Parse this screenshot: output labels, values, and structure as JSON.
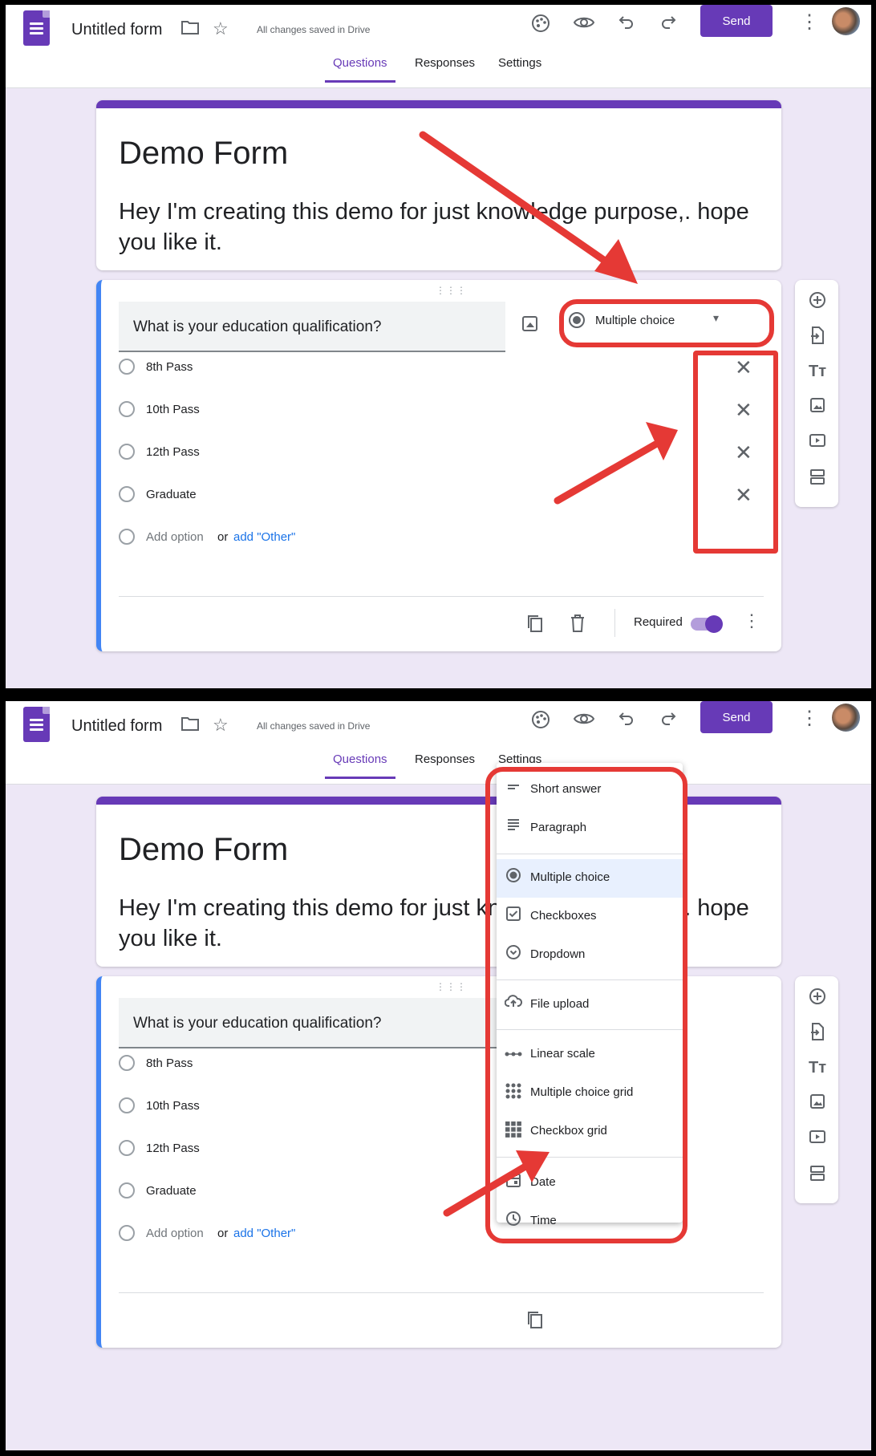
{
  "app": {
    "title": "Untitled form",
    "saved_status": "All changes saved in Drive",
    "send_label": "Send",
    "tabs": [
      "Questions",
      "Responses",
      "Settings"
    ]
  },
  "form": {
    "title": "Demo Form",
    "description": "Hey I'm creating this demo for just knowledge purpose,. hope you like it."
  },
  "question": {
    "text": "What is your education qualification?",
    "type": "Multiple choice",
    "options": [
      "8th Pass",
      "10th Pass",
      "12th Pass",
      "Graduate"
    ],
    "add_option": "Add option",
    "or_label": "or",
    "add_other": "add \"Other\"",
    "required_label": "Required",
    "required": true
  },
  "type_menu": {
    "items": [
      "Short answer",
      "Paragraph",
      "Multiple choice",
      "Checkboxes",
      "Dropdown",
      "File upload",
      "Linear scale",
      "Multiple choice grid",
      "Checkbox grid",
      "Date",
      "Time"
    ],
    "selected": "Multiple choice"
  },
  "icons": {
    "folder": "folder-icon",
    "star": "star-icon",
    "palette": "palette-icon",
    "preview": "eye-icon",
    "undo": "undo-icon",
    "redo": "redo-icon",
    "more": "kebab-icon"
  },
  "colors": {
    "brand": "#673ab7",
    "question_accent": "#4285f4",
    "annotation": "#e53935",
    "background": "#ede7f6"
  }
}
